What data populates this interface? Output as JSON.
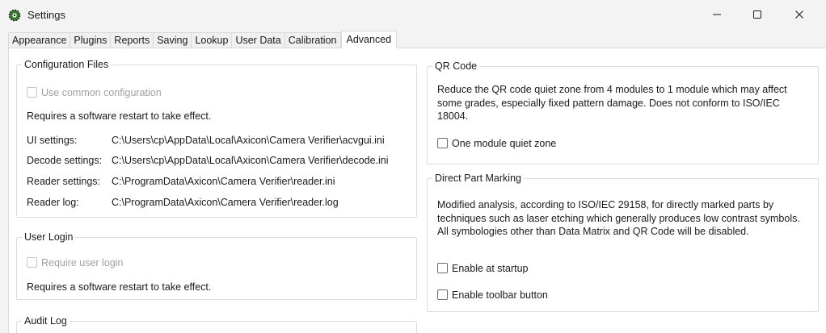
{
  "window": {
    "title": "Settings",
    "icon": "settings-gear-icon"
  },
  "tabs": [
    "Appearance",
    "Plugins",
    "Reports",
    "Saving",
    "Lookup",
    "User Data",
    "Calibration",
    "Advanced"
  ],
  "active_tab": "Advanced",
  "config_files": {
    "title": "Configuration Files",
    "use_common_label": "Use common configuration",
    "restart_note": "Requires a software restart to take effect.",
    "rows": [
      {
        "label": "UI settings:",
        "path": "C:\\Users\\cp\\AppData\\Local\\Axicon\\Camera Verifier\\acvgui.ini"
      },
      {
        "label": "Decode settings:",
        "path": "C:\\Users\\cp\\AppData\\Local\\Axicon\\Camera Verifier\\decode.ini"
      },
      {
        "label": "Reader settings:",
        "path": "C:\\ProgramData\\Axicon\\Camera Verifier\\reader.ini"
      },
      {
        "label": "Reader log:",
        "path": "C:\\ProgramData\\Axicon\\Camera Verifier\\reader.log"
      }
    ]
  },
  "user_login": {
    "title": "User Login",
    "require_label": "Require user login",
    "restart_note": "Requires a software restart to take effect."
  },
  "audit_log": {
    "title": "Audit Log"
  },
  "qr_code": {
    "title": "QR Code",
    "description": "Reduce the QR code quiet zone from 4 modules to 1 module which may affect some grades, especially fixed pattern damage.  Does not conform to ISO/IEC 18004.",
    "one_module_label": "One module quiet zone"
  },
  "dpm": {
    "title": "Direct Part Marking",
    "description": "Modified analysis, according to ISO/IEC 29158, for directly marked parts by techniques such as laser etching which generally produces low contrast symbols.  All symbologies other than Data Matrix and QR Code will be disabled.",
    "enable_startup_label": "Enable at startup",
    "enable_toolbar_label": "Enable toolbar button"
  }
}
